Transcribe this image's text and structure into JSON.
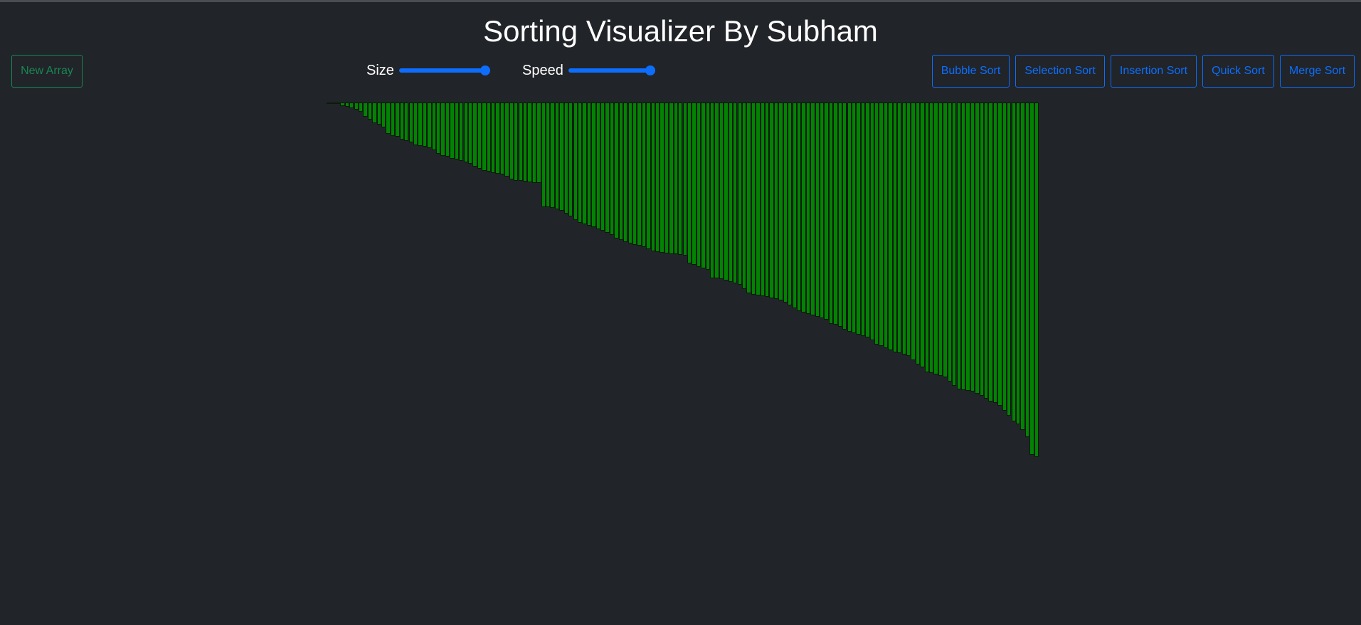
{
  "header": {
    "title": "Sorting Visualizer By Subham"
  },
  "toolbar": {
    "new_array_label": "New Array",
    "size_label": "Size",
    "speed_label": "Speed",
    "size_value_fraction": 1.0,
    "speed_value_fraction": 1.0,
    "sort_buttons": [
      {
        "label": "Bubble Sort"
      },
      {
        "label": "Selection Sort"
      },
      {
        "label": "Insertion Sort"
      },
      {
        "label": "Quick Sort"
      },
      {
        "label": "Merge Sort"
      }
    ]
  },
  "colors": {
    "background": "#212428",
    "bar": "#038203",
    "primary": "#0d6efd",
    "success": "#198754"
  },
  "chart_data": {
    "type": "bar",
    "state": "sorted ascending",
    "values": [
      1,
      1,
      2,
      5,
      6,
      8,
      10,
      13,
      20,
      24,
      29,
      31,
      35,
      44,
      47,
      48,
      52,
      54,
      56,
      60,
      61,
      62,
      64,
      67,
      72,
      75,
      76,
      79,
      80,
      82,
      84,
      86,
      90,
      93,
      96,
      97,
      99,
      100,
      101,
      104,
      108,
      110,
      110,
      111,
      112,
      113,
      113,
      147,
      147,
      148,
      150,
      152,
      156,
      160,
      165,
      169,
      171,
      173,
      175,
      178,
      180,
      183,
      186,
      191,
      193,
      196,
      198,
      200,
      201,
      203,
      206,
      209,
      210,
      211,
      212,
      213,
      213,
      214,
      215,
      226,
      228,
      231,
      233,
      235,
      247,
      247,
      248,
      250,
      252,
      254,
      256,
      262,
      268,
      270,
      271,
      272,
      273,
      275,
      276,
      278,
      281,
      285,
      289,
      293,
      295,
      297,
      299,
      301,
      303,
      305,
      311,
      312,
      315,
      319,
      322,
      324,
      326,
      328,
      330,
      334,
      340,
      342,
      345,
      348,
      351,
      352,
      354,
      356,
      362,
      368,
      372,
      379,
      380,
      382,
      384,
      386,
      392,
      398,
      403,
      404,
      405,
      406,
      409,
      412,
      416,
      420,
      422,
      426,
      433,
      440,
      448,
      452,
      460,
      470,
      495,
      498
    ]
  }
}
